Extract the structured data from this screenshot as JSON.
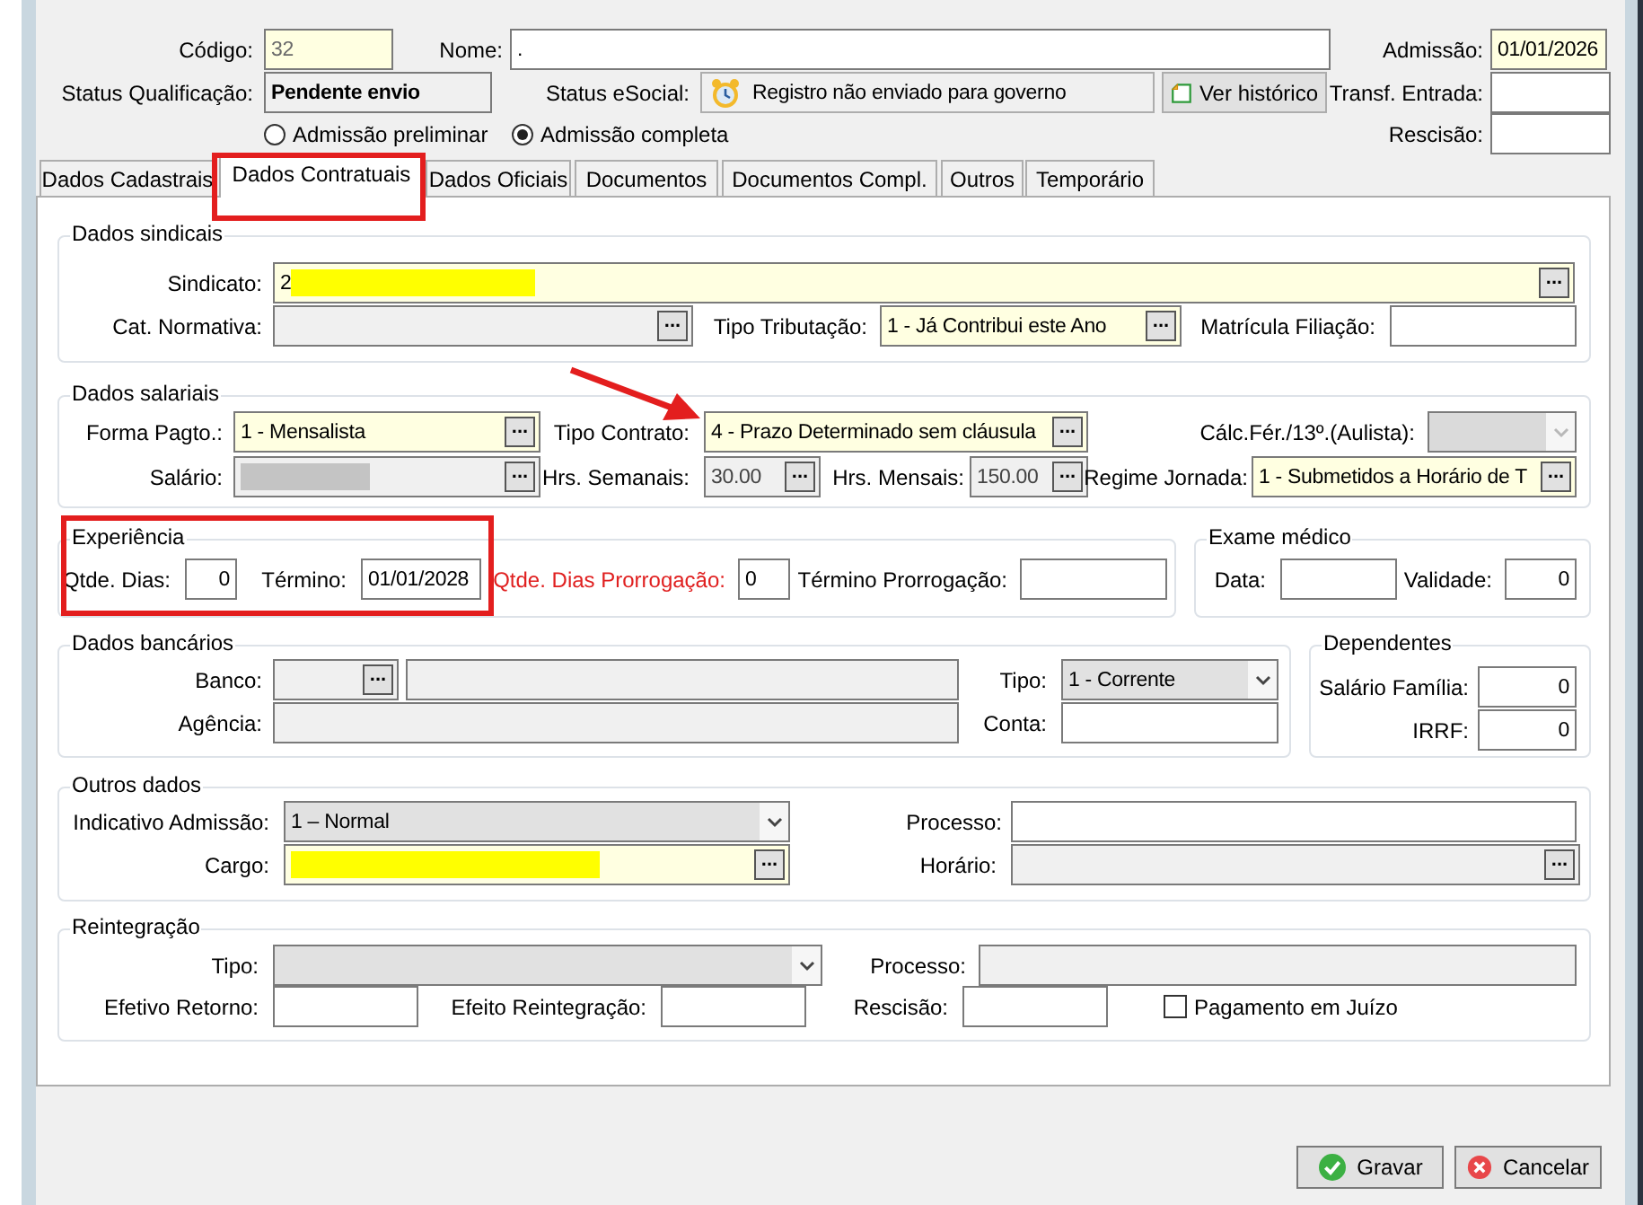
{
  "header": {
    "rows": [
      {
        "items": [
          {
            "kind": "text",
            "label": "Código:",
            "value": "32",
            "required": true,
            "disabled": true
          },
          {
            "kind": "text",
            "label": "Nome:",
            "value": ".",
            "required": false,
            "disabled": false
          },
          {
            "kind": "text",
            "label": "Admissão:",
            "value": "01/01/2026",
            "required": true,
            "disabled": false
          }
        ]
      },
      {
        "items": [
          {
            "kind": "display",
            "label": "Status Qualificação:",
            "value": "Pendente envio"
          },
          {
            "kind": "status",
            "label": "Status eSocial:",
            "value": "Registro não enviado para governo"
          },
          {
            "kind": "button",
            "label": "Ver histórico"
          },
          {
            "kind": "text",
            "label": "Transf. Entrada:",
            "required": false,
            "disabled": false
          }
        ]
      },
      {
        "items": [
          {
            "kind": "radio",
            "label": "Admissão preliminar",
            "selected": false
          },
          {
            "kind": "radio",
            "label": "Admissão completa",
            "selected": true
          },
          {
            "kind": "text",
            "label": "Rescisão:",
            "required": false,
            "disabled": false
          }
        ]
      }
    ]
  },
  "tabs": [
    {
      "label": "Dados Cadastrais",
      "selected": false
    },
    {
      "label": "Dados Contratuais",
      "selected": true
    },
    {
      "label": "Dados Oficiais",
      "selected": false
    },
    {
      "label": "Documentos",
      "selected": false
    },
    {
      "label": "Documentos Compl.",
      "selected": false
    },
    {
      "label": "Outros",
      "selected": false
    },
    {
      "label": "Temporário",
      "selected": false
    }
  ],
  "groups": [
    {
      "title": "Dados sindicais",
      "rows": [
        {
          "items": [
            {
              "kind": "lookup",
              "label": "Sindicato:",
              "value": "2",
              "color": "#ffff00",
              "button": "...",
              "required": true,
              "disabled": false
            }
          ]
        },
        {
          "items": [
            {
              "kind": "lookup",
              "label": "Cat. Normativa:",
              "button": "...",
              "required": false,
              "disabled": true
            },
            {
              "kind": "lookup",
              "label": "Tipo Tributação:",
              "value": "1 - Já Contribui este Ano",
              "button": "...",
              "required": true,
              "disabled": false
            },
            {
              "kind": "text",
              "label": "Matrícula Filiação:",
              "required": false,
              "disabled": false
            }
          ]
        }
      ]
    },
    {
      "title": "Dados salariais",
      "rows": [
        {
          "items": [
            {
              "kind": "lookup",
              "label": "Forma Pagto.:",
              "value": "1  -  Mensalista",
              "button": "...",
              "required": true,
              "disabled": false
            },
            {
              "kind": "lookup",
              "label": "Tipo Contrato:",
              "value": "4 - Prazo Determinado sem cláusula",
              "button": "...",
              "required": true,
              "disabled": false
            },
            {
              "kind": "select",
              "label": "Cálc.Fér./13º.(Aulista):",
              "required": false,
              "disabled": true
            }
          ]
        },
        {
          "items": [
            {
              "kind": "lookup",
              "label": "Salário:",
              "color": "#c4c4c4",
              "button": "...",
              "required": false,
              "disabled": true
            },
            {
              "kind": "lookup",
              "label": "Hrs. Semanais:",
              "value": "30.00",
              "button": "...",
              "required": false,
              "disabled": true
            },
            {
              "kind": "lookup",
              "label": "Hrs. Mensais:",
              "value": "150.00",
              "button": "...",
              "required": false,
              "disabled": true
            },
            {
              "kind": "lookup",
              "label": "Regime Jornada:",
              "value": "1 - Submetidos a Horário de T",
              "button": "...",
              "required": true,
              "disabled": false
            }
          ]
        }
      ]
    },
    {
      "title": "Experiência",
      "rows": [
        {
          "items": [
            {
              "kind": "text",
              "label": "Qtde. Dias:",
              "value": "0",
              "warning": false,
              "required": false,
              "disabled": false
            },
            {
              "kind": "text",
              "label": "Término:",
              "value": "01/01/2028",
              "warning": false,
              "required": false,
              "disabled": false
            },
            {
              "kind": "text",
              "label": "Qtde. Dias Prorrogação:",
              "value": "0",
              "warning": true,
              "required": false,
              "disabled": false
            },
            {
              "kind": "text",
              "label": "Término Prorrogação:",
              "warning": false,
              "required": false,
              "disabled": false
            }
          ]
        }
      ]
    },
    {
      "title": "Exame médico",
      "rows": [
        {
          "items": [
            {
              "kind": "text",
              "label": "Data:",
              "required": false,
              "disabled": false
            },
            {
              "kind": "text",
              "label": "Validade:",
              "value": "0",
              "required": false,
              "disabled": false
            }
          ]
        }
      ]
    },
    {
      "title": "Dados bancários",
      "rows": [
        {
          "items": [
            {
              "kind": "lookup",
              "label": "Banco:",
              "button": "...",
              "required": false,
              "disabled": true
            },
            {
              "kind": "text",
              "required": false,
              "disabled": true
            },
            {
              "kind": "select",
              "label": "Tipo:",
              "value": "1 - Corrente",
              "required": false,
              "disabled": false
            }
          ]
        },
        {
          "items": [
            {
              "kind": "text",
              "label": "Agência:",
              "required": false,
              "disabled": true
            },
            {
              "kind": "text",
              "label": "Conta:",
              "required": false,
              "disabled": false
            }
          ]
        }
      ]
    },
    {
      "title": "Dependentes",
      "rows": [
        {
          "items": [
            {
              "kind": "text",
              "label": "Salário Família:",
              "value": "0",
              "required": false,
              "disabled": false
            }
          ]
        },
        {
          "items": [
            {
              "kind": "text",
              "label": "IRRF:",
              "value": "0",
              "required": false,
              "disabled": false
            }
          ]
        }
      ]
    },
    {
      "title": "Outros dados",
      "rows": [
        {
          "items": [
            {
              "kind": "select",
              "label": "Indicativo Admissão:",
              "value": "1 – Normal",
              "required": false,
              "disabled": false
            },
            {
              "kind": "text",
              "label": "Processo:",
              "required": false,
              "disabled": false
            }
          ]
        },
        {
          "items": [
            {
              "kind": "lookup",
              "label": "Cargo:",
              "color": "#ffff00",
              "button": "...",
              "required": true,
              "disabled": false
            },
            {
              "kind": "lookup",
              "label": "Horário:",
              "button": "...",
              "required": false,
              "disabled": true
            }
          ]
        }
      ]
    },
    {
      "title": "Reintegração",
      "rows": [
        {
          "items": [
            {
              "kind": "select",
              "label": "Tipo:",
              "required": false,
              "disabled": false
            },
            {
              "kind": "text",
              "label": "Processo:",
              "required": false,
              "disabled": true
            }
          ]
        },
        {
          "items": [
            {
              "kind": "text",
              "label": "Efetivo Retorno:",
              "required": false,
              "disabled": false
            },
            {
              "kind": "text",
              "label": "Efeito Reintegração:",
              "required": false,
              "disabled": false
            },
            {
              "kind": "text",
              "label": "Rescisão:",
              "required": false,
              "disabled": false
            },
            {
              "kind": "checkbox",
              "label": "Pagamento em Juízo",
              "checked": false
            }
          ]
        }
      ]
    }
  ],
  "buttons": [
    {
      "kind": "save",
      "label": "Gravar"
    },
    {
      "kind": "cancel",
      "label": "Cancelar"
    }
  ]
}
